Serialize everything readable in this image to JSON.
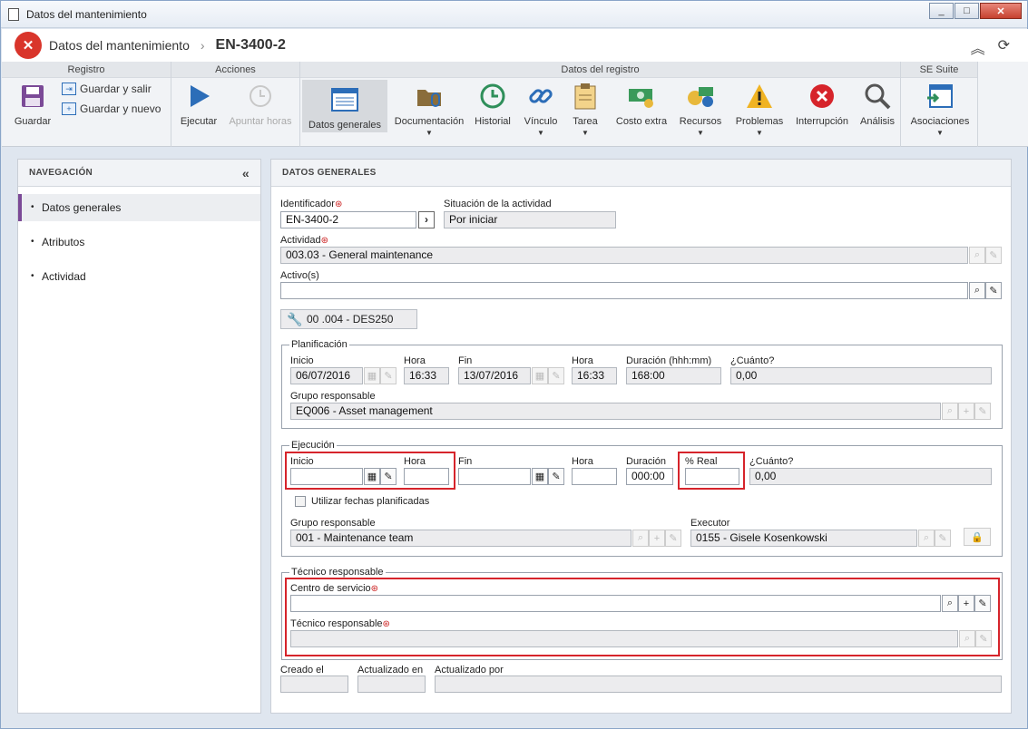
{
  "window": {
    "title": "Datos del mantenimiento",
    "controls": [
      "_",
      "□",
      "✕"
    ]
  },
  "header": {
    "title": "Datos del mantenimiento",
    "separator": "›",
    "code": "EN-3400-2"
  },
  "ribbon": {
    "groups": {
      "registro": "Registro",
      "acciones": "Acciones",
      "datos": "Datos del registro",
      "suite": "SE Suite"
    },
    "guardar": "Guardar",
    "guardar_salir": "Guardar y salir",
    "guardar_nuevo": "Guardar y nuevo",
    "ejecutar": "Ejecutar",
    "apuntar": "Apuntar horas",
    "datos_generales": "Datos generales",
    "documentacion": "Documentación",
    "historial": "Historial",
    "vinculo": "Vínculo",
    "tarea": "Tarea",
    "costo": "Costo extra",
    "recursos": "Recursos",
    "problemas": "Problemas",
    "interrupcion": "Interrupción",
    "analisis": "Análisis",
    "asociaciones": "Asociaciones"
  },
  "nav": {
    "title": "NAVEGACIÓN",
    "items": [
      {
        "label": "Datos generales"
      },
      {
        "label": "Atributos"
      },
      {
        "label": "Actividad"
      }
    ]
  },
  "main": {
    "title": "DATOS GENERALES",
    "identificador_label": "Identificador",
    "identificador": "EN-3400-2",
    "situacion_label": "Situación de la actividad",
    "situacion": "Por iniciar",
    "actividad_label": "Actividad",
    "actividad": "003.03 - General maintenance",
    "activo_label": "Activo(s)",
    "activo": "",
    "activo_chip": "00 .004 - DES250",
    "plan": {
      "legend": "Planificación",
      "inicio_label": "Inicio",
      "inicio": "06/07/2016",
      "hora_label": "Hora",
      "hora_inicio": "16:33",
      "fin_label": "Fin",
      "fin": "13/07/2016",
      "hora_fin": "16:33",
      "duracion_label": "Duración (hhh:mm)",
      "duracion": "168:00",
      "cuanto_label": "¿Cuánto?",
      "cuanto": "0,00",
      "grupo_label": "Grupo responsable",
      "grupo": "EQ006 - Asset management"
    },
    "ejec": {
      "legend": "Ejecución",
      "inicio_label": "Inicio",
      "inicio": "",
      "hora_label": "Hora",
      "hora_inicio": "",
      "fin_label": "Fin",
      "fin": "",
      "hora_fin": "",
      "duracion_label": "Duración",
      "duracion": "000:00",
      "real_label": "% Real",
      "real": "",
      "cuanto_label": "¿Cuánto?",
      "cuanto": "0,00",
      "usar_label": "Utilizar fechas planificadas",
      "grupo_label": "Grupo responsable",
      "grupo": "001 - Maintenance team",
      "executor_label": "Executor",
      "executor": "0155 - Gisele Kosenkowski"
    },
    "tecnico": {
      "legend": "Técnico responsable",
      "centro_label": "Centro de servicio",
      "centro": "",
      "tecnico_label": "Técnico responsable",
      "tecnico": ""
    },
    "creado_label": "Creado el",
    "creado": "",
    "actualizado_en_label": "Actualizado en",
    "actualizado_en": "",
    "actualizado_por_label": "Actualizado por",
    "actualizado_por": ""
  }
}
